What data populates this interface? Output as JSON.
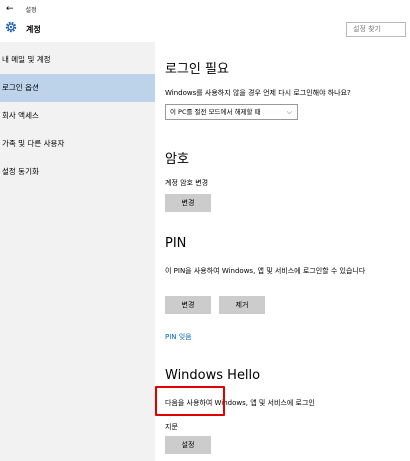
{
  "window": {
    "back_glyph": "←",
    "title": "설정"
  },
  "header": {
    "app_name": "계정",
    "search_placeholder": "설정 찾기",
    "icon": "gear-icon"
  },
  "sidebar": {
    "items": [
      {
        "label": "내 메일 및 계정",
        "active": false
      },
      {
        "label": "로그인 옵션",
        "active": true
      },
      {
        "label": "회사 액세스",
        "active": false
      },
      {
        "label": "가족 및 다른 사용자",
        "active": false
      },
      {
        "label": "설정 동기화",
        "active": false
      }
    ]
  },
  "main": {
    "signin_required": {
      "heading": "로그인 필요",
      "description": "Windows를 사용하지 않을 경우 언제 다시 로그인해야 하나요?",
      "select_value": "이 PC를 절전 모드에서 해제할 때"
    },
    "password": {
      "heading": "암호",
      "description": "계정 암호 변경",
      "change_button": "변경"
    },
    "pin": {
      "heading": "PIN",
      "description": "이 PIN을 사용하여 Windows, 앱 및 서비스에 로그인할 수 있습니다",
      "change_button": "변경",
      "remove_button": "제거",
      "forgot_link": "PIN 잊음"
    },
    "hello": {
      "heading": "Windows Hello",
      "description": "다음을 사용하여 Windows, 앱 및 서비스에 로그인",
      "sub_label": "지문",
      "setup_button": "설정"
    }
  },
  "colors": {
    "sidebar_bg": "#f2f2f2",
    "active_item": "#bcd3ea",
    "button_bg": "#cccccc",
    "link": "#0063b1",
    "highlight": "#e00000"
  }
}
